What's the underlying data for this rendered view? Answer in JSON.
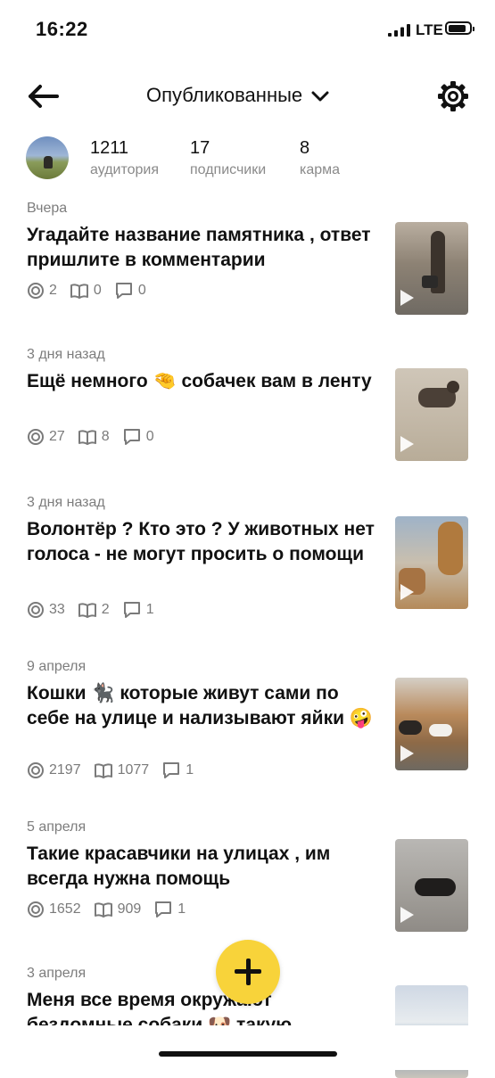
{
  "status_bar": {
    "time": "16:22",
    "network": "LTE"
  },
  "header": {
    "title": "Опубликованные",
    "back_icon": "arrow-left-icon",
    "dropdown_icon": "chevron-down-icon",
    "settings_icon": "gear-icon"
  },
  "stats": [
    {
      "value": "1211",
      "label": "аудитория"
    },
    {
      "value": "17",
      "label": "подписчики"
    },
    {
      "value": "8",
      "label": "карма"
    }
  ],
  "posts": [
    {
      "date": "Вчера",
      "title": "Угадайте название памятника , ответ пришлите в комментарии",
      "views": "2",
      "reads": "0",
      "comments": "0",
      "has_video": true
    },
    {
      "date": "3 дня назад",
      "title": "Ещё немного 🤏 собачек вам в ленту",
      "views": "27",
      "reads": "8",
      "comments": "0",
      "has_video": true
    },
    {
      "date": "3 дня назад",
      "title": "Волонтёр ? Кто это ? У животных нет голоса - не могут просить о помощи",
      "views": "33",
      "reads": "2",
      "comments": "1",
      "has_video": true
    },
    {
      "date": "9 апреля",
      "title": "Кошки 🐈‍⬛ которые живут сами по себе на улице и нализывают яйки 🤪",
      "views": "2197",
      "reads": "1077",
      "comments": "1",
      "has_video": true
    },
    {
      "date": "5 апреля",
      "title": "Такие красавчики на улицах , им всегда нужна помощь",
      "views": "1652",
      "reads": "909",
      "comments": "1",
      "has_video": true
    },
    {
      "date": "3 апреля",
      "title": "Меня все время окружают бездомные собаки 🐶 такую",
      "views": "",
      "reads": "",
      "comments": "",
      "has_video": false
    }
  ],
  "fab": {
    "icon": "plus-icon"
  },
  "colors": {
    "accent": "#f8d33a",
    "muted": "#7d7d7d"
  }
}
